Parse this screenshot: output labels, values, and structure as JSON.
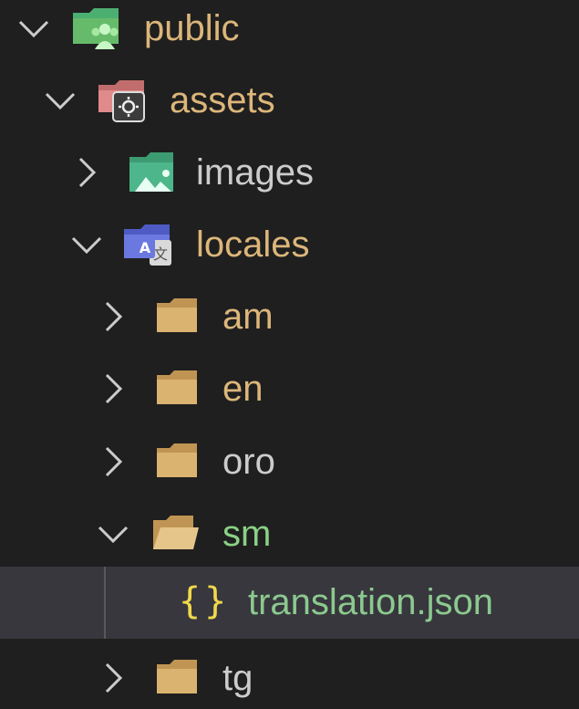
{
  "explorer": {
    "items": [
      {
        "label": "public",
        "expanded": true,
        "icon": "folder-public-icon"
      },
      {
        "label": "assets",
        "expanded": true,
        "icon": "folder-assets-icon"
      },
      {
        "label": "images",
        "expanded": false,
        "icon": "folder-images-icon"
      },
      {
        "label": "locales",
        "expanded": true,
        "icon": "folder-locales-icon"
      },
      {
        "label": "am",
        "expanded": false,
        "icon": "folder-icon"
      },
      {
        "label": "en",
        "expanded": false,
        "icon": "folder-icon"
      },
      {
        "label": "oro",
        "expanded": false,
        "icon": "folder-icon"
      },
      {
        "label": "sm",
        "expanded": true,
        "icon": "folder-open-icon"
      },
      {
        "label": "translation.json",
        "icon": "json-braces-icon",
        "selected": true,
        "braces": "{}"
      },
      {
        "label": "tg",
        "expanded": false,
        "icon": "folder-icon"
      }
    ]
  },
  "colors": {
    "background": "#1f1f1f",
    "selected_row": "#37373d",
    "folder_label": "#dcb67a",
    "modified_label": "#89d185",
    "json_braces": "#f1d84b"
  }
}
